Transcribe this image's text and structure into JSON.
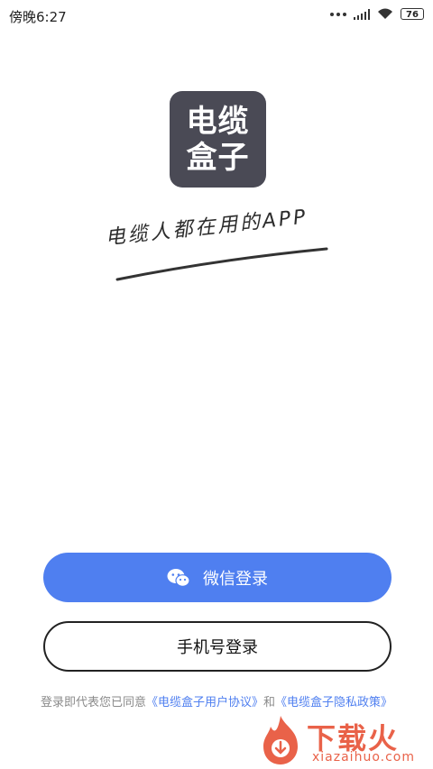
{
  "status_bar": {
    "time": "傍晚6:27",
    "battery": "76"
  },
  "app": {
    "logo_line1": "电缆",
    "logo_line2": "盒子",
    "slogan": "电缆人都在用的APP"
  },
  "buttons": {
    "wechat_login": "微信登录",
    "phone_login": "手机号登录"
  },
  "agreement": {
    "prefix": "登录即代表您已同意",
    "user_agreement": "《电缆盒子用户协议》",
    "conjunction": "和",
    "privacy_policy": "《电缆盒子隐私政策》"
  },
  "watermark": {
    "title": "下载火",
    "url": "xiazaihuo.com"
  },
  "colors": {
    "primary": "#4f7ff0",
    "logo_bg": "#4a4a55",
    "watermark": "#e8553a"
  }
}
